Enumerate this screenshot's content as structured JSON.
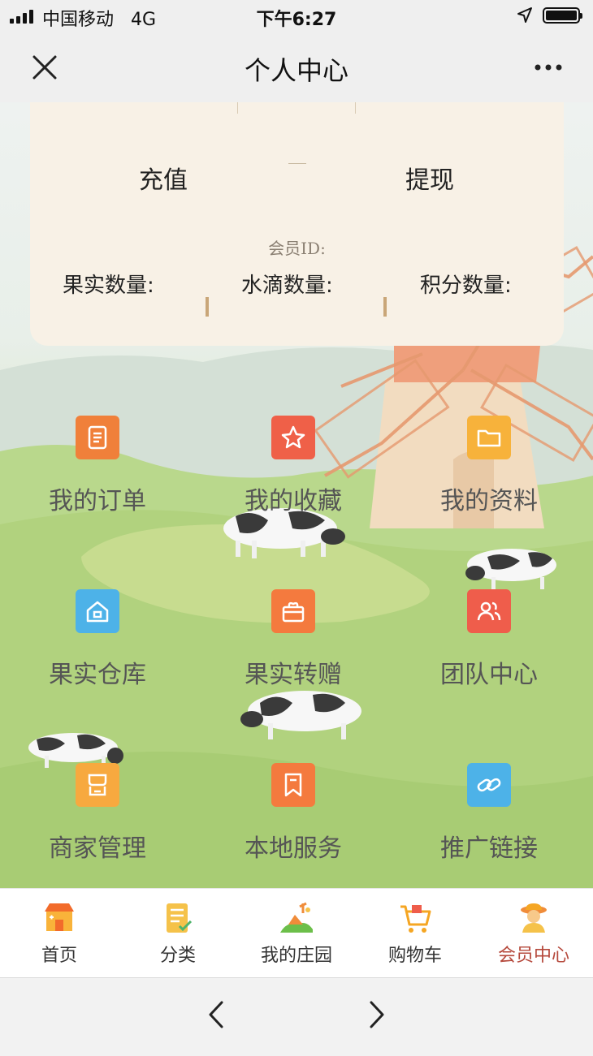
{
  "status_bar": {
    "carrier": "中国移动",
    "network": "4G",
    "time": "下午6:27"
  },
  "nav": {
    "title": "个人中心",
    "close_icon": "close-icon",
    "more_icon": "more-icon"
  },
  "card": {
    "recharge": "充值",
    "withdraw": "提现",
    "member_id": "会员ID:",
    "stats": [
      "果实数量:",
      "水滴数量:",
      "积分数量:"
    ]
  },
  "grid": [
    {
      "label": "我的订单",
      "icon": "order-icon",
      "color": "#f0803a"
    },
    {
      "label": "我的收藏",
      "icon": "star-icon",
      "color": "#ef6048"
    },
    {
      "label": "我的资料",
      "icon": "folder-icon",
      "color": "#f7b23b"
    },
    {
      "label": "果实仓库",
      "icon": "home-icon",
      "color": "#4db2e8"
    },
    {
      "label": "果实转赠",
      "icon": "gift-icon",
      "color": "#f47a3e"
    },
    {
      "label": "团队中心",
      "icon": "team-icon",
      "color": "#ef5d4b"
    },
    {
      "label": "商家管理",
      "icon": "store-icon",
      "color": "#f7a93f"
    },
    {
      "label": "本地服务",
      "icon": "bookmark-icon",
      "color": "#f47a3e"
    },
    {
      "label": "推广链接",
      "icon": "link-icon",
      "color": "#4db2e8"
    }
  ],
  "tabbar": [
    {
      "label": "首页",
      "icon": "shop-icon"
    },
    {
      "label": "分类",
      "icon": "checklist-icon"
    },
    {
      "label": "我的庄园",
      "icon": "farm-icon"
    },
    {
      "label": "购物车",
      "icon": "cart-icon"
    },
    {
      "label": "会员中心",
      "icon": "member-icon",
      "active": true
    }
  ],
  "colors": {
    "active_tab": "#b5483b",
    "card_bg": "#f8f1e6"
  }
}
